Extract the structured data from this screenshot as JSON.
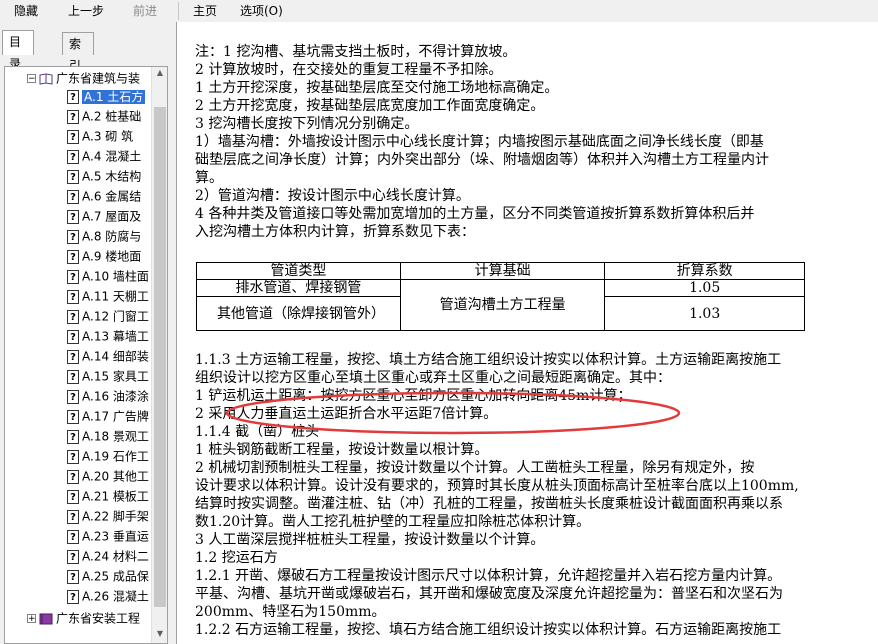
{
  "toolbar": {
    "hide": "隐藏",
    "back": "上一步",
    "forward": "前进",
    "home": "主页",
    "options": "选项(O)"
  },
  "tabs": {
    "contents": "目录(C)",
    "index": "索引(N)"
  },
  "tree": {
    "root": "广东省建筑与装",
    "items": [
      "A.1  土石方",
      "A.2  桩基础",
      "A.3  砌  筑",
      "A.4  混凝土",
      "A.5  木结构",
      "A.6  金属结",
      "A.7  屋面及",
      "A.8  防腐与",
      "A.9  楼地面",
      "A.10  墙柱面",
      "A.11  天棚工",
      "A.12  门窗工",
      "A.13  幕墙工",
      "A.14  细部装",
      "A.15  家具工",
      "A.16  油漆涂",
      "A.17  广告牌",
      "A.18  景观工",
      "A.19  石作工",
      "A.20  其他工",
      "A.21  模板工",
      "A.22  脚手架",
      "A.23  垂直运",
      "A.24  材料二",
      "A.25  成品保",
      "A.26  混凝土"
    ],
    "next_root": "广东省安装工程"
  },
  "content": {
    "lines": [
      "注：1   挖沟槽、基坑需支挡土板时，不得计算放坡。",
      "      2   计算放坡时，在交接处的重复工程量不予扣除。",
      "      1   土方开挖深度，按基础垫层底至交付施工场地标高确定。",
      "      2   土方开挖宽度，按基础垫层底宽度加工作面宽度确定。",
      "      3   挖沟槽长度按下列情况分别确定。",
      "      1）墙基沟槽：外墙按设计图示中心线长度计算；内墙按图示基础底面之间净长线长度（即基",
      "础垫层底之间净长度）计算；内外突出部分（垛、附墙烟囱等）体积并入沟槽土方工程量内计",
      "算。",
      "      2）管道沟槽：按设计图示中心线长度计算。",
      "      4   各种井类及管道接口等处需加宽增加的土方量，区分不同类管道按折算系数折算体积后并",
      "入挖沟槽土方体积内计算，折算系数见下表："
    ],
    "table": {
      "headers": [
        "管道类型",
        "计算基础",
        "折算系数"
      ],
      "row1_type": "排水管道、焊接钢管",
      "row2_type": "其他管道（除焊接钢管外）",
      "basis": "管道沟槽土方工程量",
      "row1_factor": "1.05",
      "row2_factor": "1.03"
    },
    "lines2": [
      "1.1.3   土方运输工程量，按挖、填土方结合施工组织设计按实以体积计算。土方运输距离按施工",
      "组织设计以挖方区重心至填土区重心或弃土区重心之间最短距离确定。其中：",
      "      1   铲运机运土距离：按挖方区重心至卸方区重心加转向距离45m计算；",
      "      2   采用人力垂直运土运距折合水平运距7倍计算。",
      "1.1.4   截（凿）桩头",
      "      1   桩头钢筋截断工程量，按设计数量以根计算。",
      "      2   机械切割预制桩头工程量，按设计数量以个计算。人工凿桩头工程量，除另有规定外，按",
      "设计要求以体积计算。设计没有要求的，预算时其长度从桩头顶面标高计至桩率台底以上100mm,",
      "结算时按实调整。凿灌注桩、钻（冲）孔桩的工程量，按凿桩头长度乘桩设计截面面积再乘以系",
      "数1.20计算。凿人工挖孔桩护壁的工程量应扣除桩芯体积计算。",
      "      3   人工凿深层搅拌桩桩头工程量，按设计数量以个计算。",
      "1.2   挖运石方",
      "1.2.1   开凿、爆破石方工程量按设计图示尺寸以体积计算，允许超挖量并入岩石挖方量内计算。",
      "平基、沟槽、基坑开凿或爆破岩石，其开凿和爆破宽度及深度允许超挖量为：普坚石和次坚石为",
      "200mm、特坚石为150mm。",
      "1.2.2   石方运输工程量，按挖、填石方结合施工组织设计按实以体积计算。石方运输距离按施工"
    ]
  },
  "colors": {
    "selection": "#3072d8",
    "annotation": "#e23b3b"
  },
  "icons": [
    "help-page-icon",
    "book-icon",
    "expand-icon",
    "collapse-icon"
  ]
}
